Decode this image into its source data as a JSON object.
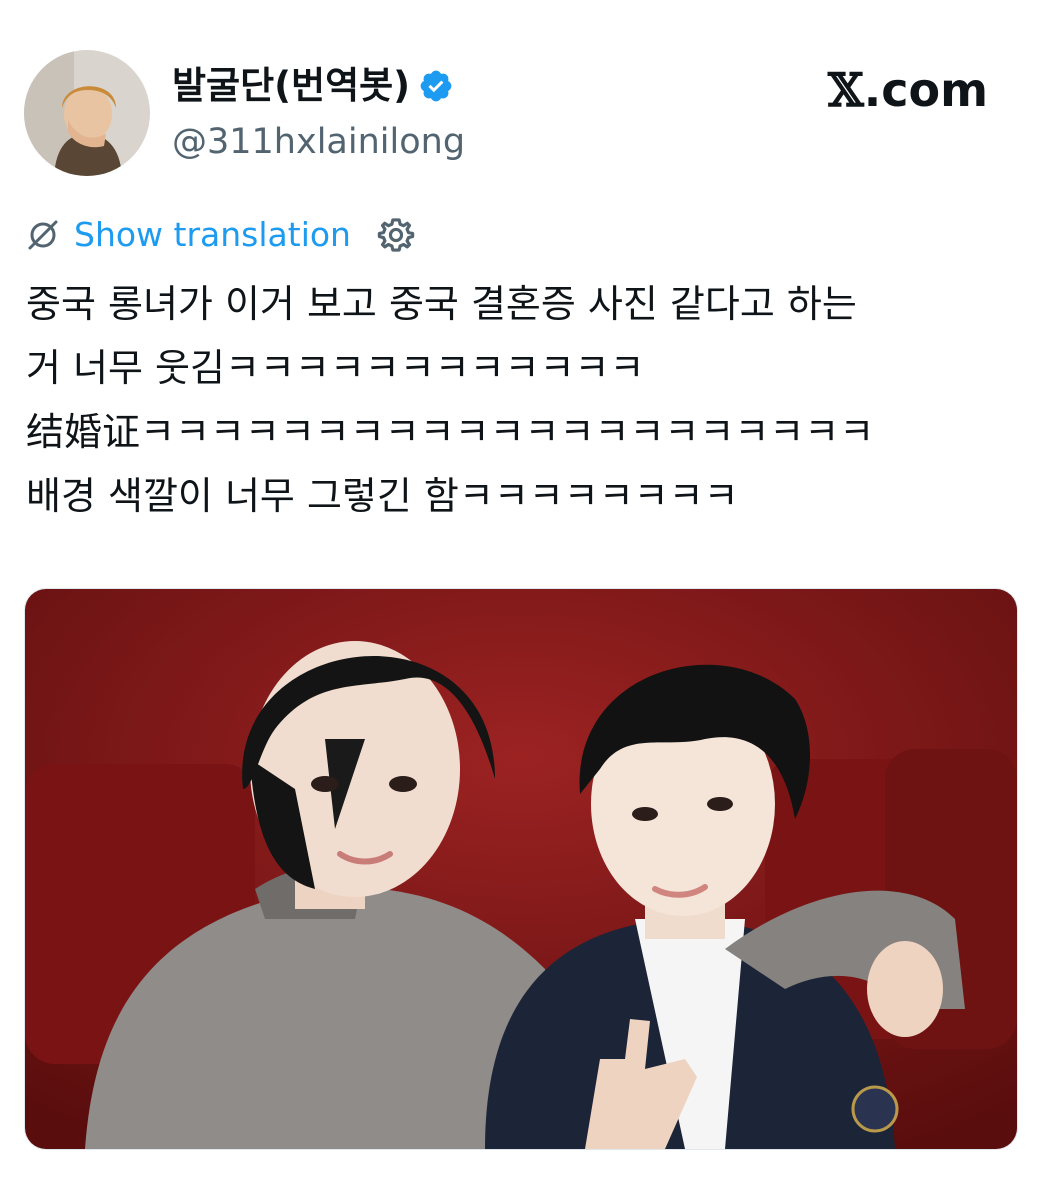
{
  "author": {
    "display_name": "발굴단(번역봇)",
    "handle": "@311hxlainilong",
    "verified": true
  },
  "brand": {
    "logo_mark": "𝕏",
    "logo_text": ".com"
  },
  "translation": {
    "label": "Show translation",
    "icon": "globe-strikethrough-icon",
    "settings_icon": "gear-icon"
  },
  "tweet": {
    "lines": [
      "중국 롱녀가 이거 보고 중국 결혼증 사진 같다고 하는",
      "거 너무 웃김ㅋㅋㅋㅋㅋㅋㅋㅋㅋㅋㅋㅋ",
      "结婚证ㅋㅋㅋㅋㅋㅋㅋㅋㅋㅋㅋㅋㅋㅋㅋㅋㅋㅋㅋㅋㅋ",
      "배경 색깔이 너무 그렇긴 함ㅋㅋㅋㅋㅋㅋㅋㅋ"
    ]
  },
  "colors": {
    "accent": "#1d9bf0",
    "text": "#0f1419",
    "secondary": "#536471",
    "photo_background": "#8a1a1a"
  }
}
